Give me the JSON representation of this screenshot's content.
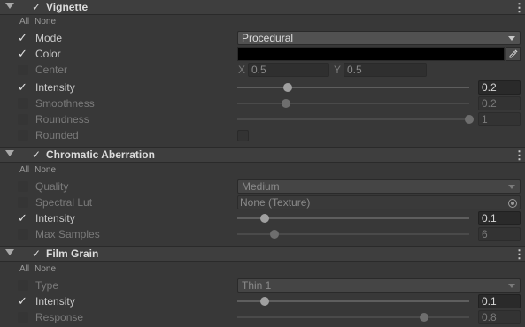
{
  "sections": [
    {
      "title": "Vignette",
      "all": "All",
      "none": "None",
      "mode": {
        "label": "Mode",
        "value": "Procedural"
      },
      "color": {
        "label": "Color",
        "value": "#000000"
      },
      "center": {
        "label": "Center",
        "x_label": "X",
        "x": "0.5",
        "y_label": "Y",
        "y": "0.5"
      },
      "intensity": {
        "label": "Intensity",
        "value": "0.2",
        "slider_fraction": 0.2
      },
      "smoothness": {
        "label": "Smoothness",
        "value": "0.2",
        "slider_fraction": 0.2
      },
      "roundness": {
        "label": "Roundness",
        "value": "1",
        "slider_fraction": 1
      },
      "rounded": {
        "label": "Rounded"
      }
    },
    {
      "title": "Chromatic Aberration",
      "all": "All",
      "none": "None",
      "quality": {
        "label": "Quality",
        "value": "Medium"
      },
      "spectral_lut": {
        "label": "Spectral Lut",
        "value": "None (Texture)"
      },
      "intensity": {
        "label": "Intensity",
        "value": "0.1",
        "slider_fraction": 0.1
      },
      "max_samples": {
        "label": "Max Samples",
        "value": "6",
        "slider_fraction": 0.17
      }
    },
    {
      "title": "Film Grain",
      "all": "All",
      "none": "None",
      "type": {
        "label": "Type",
        "value": "Thin 1"
      },
      "intensity": {
        "label": "Intensity",
        "value": "0.1",
        "slider_fraction": 0.1
      },
      "response": {
        "label": "Response",
        "value": "0.8",
        "slider_fraction": 0.8
      }
    }
  ],
  "icons": {
    "foldout": "triangle-down-icon",
    "kebab": "kebab-menu-icon",
    "picker": "eyedropper-icon",
    "object_picker": "object-target-icon"
  },
  "colors": {
    "background": "#383838",
    "header": "#3e3e3e",
    "field": "#2a2a2a",
    "dropdown": "#515151"
  }
}
